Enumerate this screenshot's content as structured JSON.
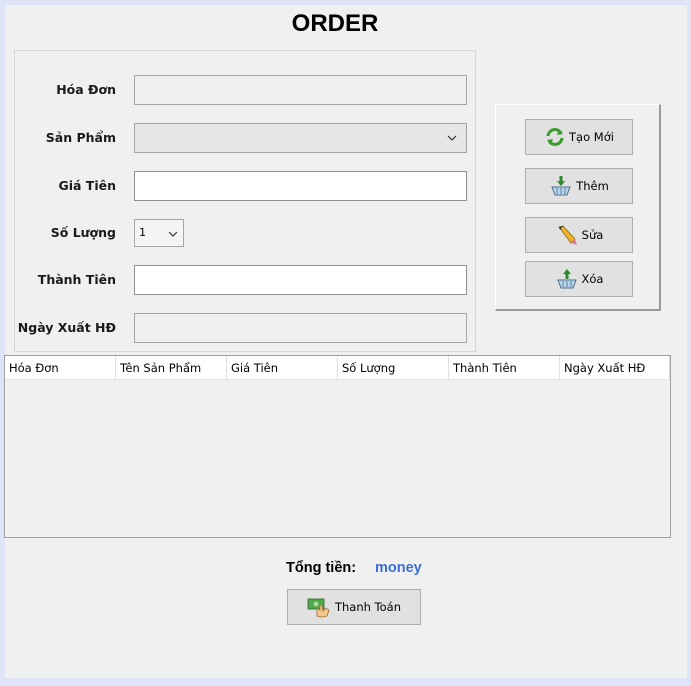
{
  "title": "ORDER",
  "form": {
    "invoice_label": "Hóa Đơn",
    "product_label": "Sản Phẩm",
    "price_label": "Giá Tiên",
    "quantity_label": "Số Lượng",
    "quantity_value": "1",
    "subtotal_label": "Thành Tiên",
    "date_label": "Ngày Xuất HĐ"
  },
  "actions": {
    "new_label": "Tạo Mới",
    "add_label": "Thêm",
    "edit_label": "Sửa",
    "delete_label": "Xóa"
  },
  "grid": {
    "columns": [
      "Hóa Đơn",
      "Tên Sản Phẩm",
      "Giá Tiên",
      "Số Lượng",
      "Thành Tiên",
      "Ngày Xuất HĐ"
    ]
  },
  "total": {
    "label": "Tổng tiền:",
    "value": "money"
  },
  "pay": {
    "label": "Thanh Toán"
  },
  "icons": {
    "new": "refresh-icon",
    "add": "basket-add-icon",
    "edit": "pencil-icon",
    "delete": "basket-remove-icon",
    "pay": "cash-hand-icon"
  },
  "colors": {
    "total_value": "#3c6fd6"
  }
}
